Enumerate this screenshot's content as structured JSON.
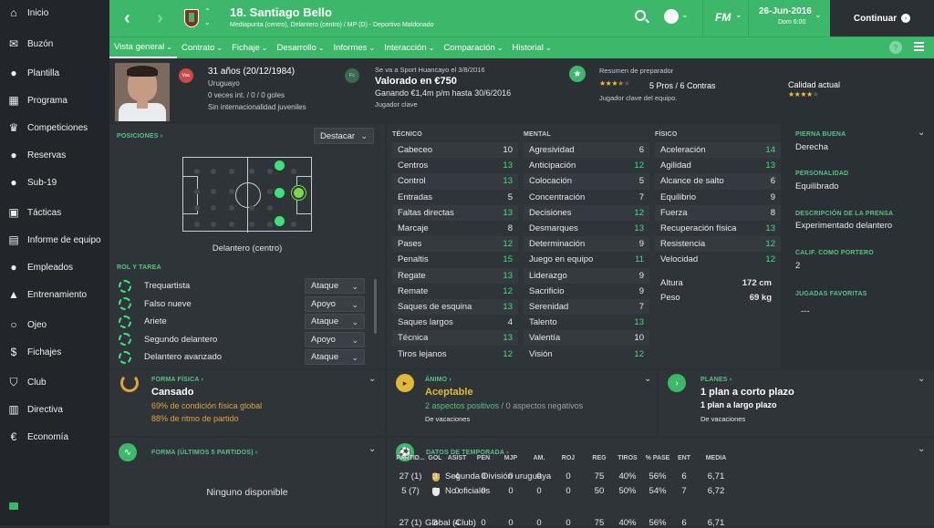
{
  "sidebar": {
    "items": [
      {
        "label": "Inicio",
        "icon": "home-icon"
      },
      {
        "label": "Buzón",
        "icon": "inbox-icon"
      },
      {
        "label": "Plantilla",
        "icon": "squad-icon"
      },
      {
        "label": "Programa",
        "icon": "schedule-icon"
      },
      {
        "label": "Competiciones",
        "icon": "trophy-icon"
      },
      {
        "label": "Reservas",
        "icon": "reserves-icon"
      },
      {
        "label": "Sub-19",
        "icon": "u19-icon"
      },
      {
        "label": "Tácticas",
        "icon": "tactics-icon"
      },
      {
        "label": "Informe de equipo",
        "icon": "report-icon"
      },
      {
        "label": "Empleados",
        "icon": "staff-icon"
      },
      {
        "label": "Entrenamiento",
        "icon": "training-icon"
      },
      {
        "label": "Ojeo",
        "icon": "scouting-icon"
      },
      {
        "label": "Fichajes",
        "icon": "transfers-icon"
      },
      {
        "label": "Club",
        "icon": "club-icon"
      },
      {
        "label": "Directiva",
        "icon": "board-icon"
      },
      {
        "label": "Economía",
        "icon": "finances-icon"
      }
    ]
  },
  "header": {
    "player_name": "18. Santiago Bello",
    "subtitle": "Mediapunta (centro), Delantero (centro) / MP (D) - Deportivo Maldonado",
    "logo": "FM",
    "date": "26-Jun-2016",
    "time": "Dom 6:00",
    "continue_label": "Continuar"
  },
  "nav": {
    "tabs": [
      "Vista general",
      "Contrato",
      "Fichaje",
      "Desarrollo",
      "Informes",
      "Interacción",
      "Comparación",
      "Historial"
    ]
  },
  "profile": {
    "age": "31 años (20/12/1984)",
    "nationality": "Uruguayo",
    "caps": "0 veces int. / 0 / 0 goles",
    "youth": "Sin internacionalidad juveniles",
    "badge": "Vac",
    "transfer_note": "Se va a Sport Huancayo el 3/8/2016",
    "value": "Valorado en €750",
    "wage": "Ganando €1,4m p/m hasta 30/6/2016",
    "status": "Jugador clave",
    "badge2": "Fc",
    "coach_title": "Resumen de preparador",
    "pros_cons": "5 Pros / 6 Contras",
    "coach_note": "Jugador clave del equipo.",
    "current_ability": "Calidad actual",
    "pros_stars": 3.5,
    "ability_stars": 4
  },
  "positions": {
    "title": "POSICIONES",
    "highlight_label": "Destacar",
    "position_label": "Delantero (centro)"
  },
  "roles": {
    "title": "ROL Y TAREA",
    "items": [
      {
        "role": "Trequartista",
        "duty": "Ataque"
      },
      {
        "role": "Falso nueve",
        "duty": "Apoyo"
      },
      {
        "role": "Ariete",
        "duty": "Ataque"
      },
      {
        "role": "Segundo delantero",
        "duty": "Apoyo"
      },
      {
        "role": "Delantero avanzado",
        "duty": "Ataque"
      }
    ]
  },
  "technical": {
    "title": "TÉCNICO",
    "items": [
      {
        "name": "Cabeceo",
        "value": "10"
      },
      {
        "name": "Centros",
        "value": "13"
      },
      {
        "name": "Control",
        "value": "13"
      },
      {
        "name": "Entradas",
        "value": "5"
      },
      {
        "name": "Faltas directas",
        "value": "13"
      },
      {
        "name": "Marcaje",
        "value": "8"
      },
      {
        "name": "Pases",
        "value": "12"
      },
      {
        "name": "Penaltis",
        "value": "15"
      },
      {
        "name": "Regate",
        "value": "13"
      },
      {
        "name": "Remate",
        "value": "12"
      },
      {
        "name": "Saques de esquina",
        "value": "13"
      },
      {
        "name": "Saques largos",
        "value": "4"
      },
      {
        "name": "Técnica",
        "value": "13"
      },
      {
        "name": "Tiros lejanos",
        "value": "12"
      }
    ]
  },
  "mental": {
    "title": "MENTAL",
    "items": [
      {
        "name": "Agresividad",
        "value": "6"
      },
      {
        "name": "Anticipación",
        "value": "12"
      },
      {
        "name": "Colocación",
        "value": "5"
      },
      {
        "name": "Concentración",
        "value": "7"
      },
      {
        "name": "Decisiones",
        "value": "12"
      },
      {
        "name": "Desmarques",
        "value": "13"
      },
      {
        "name": "Determinación",
        "value": "9"
      },
      {
        "name": "Juego en equipo",
        "value": "11"
      },
      {
        "name": "Liderazgo",
        "value": "9"
      },
      {
        "name": "Sacrificio",
        "value": "9"
      },
      {
        "name": "Serenidad",
        "value": "7"
      },
      {
        "name": "Talento",
        "value": "13"
      },
      {
        "name": "Valentía",
        "value": "10"
      },
      {
        "name": "Visión",
        "value": "12"
      }
    ]
  },
  "physical": {
    "title": "FÍSICO",
    "items": [
      {
        "name": "Aceleración",
        "value": "14"
      },
      {
        "name": "Agilidad",
        "value": "13"
      },
      {
        "name": "Alcance de salto",
        "value": "6"
      },
      {
        "name": "Equilibrio",
        "value": "9"
      },
      {
        "name": "Fuerza",
        "value": "8"
      },
      {
        "name": "Recuperación física",
        "value": "13"
      },
      {
        "name": "Resistencia",
        "value": "12"
      },
      {
        "name": "Velocidad",
        "value": "12"
      }
    ],
    "height_label": "Altura",
    "height": "172 cm",
    "weight_label": "Peso",
    "weight": "69 kg"
  },
  "details": {
    "foot_title": "PIERNA BUENA",
    "foot": "Derecha",
    "personality_title": "PERSONALIDAD",
    "personality": "Equilibrado",
    "press_title": "DESCRIPCIÓN DE LA PRENSA",
    "press": "Experimentado delantero",
    "gk_title": "CALIF. COMO PORTERO",
    "gk": "2",
    "moves_title": "JUGADAS FAVORITAS",
    "moves": "---"
  },
  "condition": {
    "title": "FORMA FÍSICA",
    "state": "Cansado",
    "line1": "69% de condición física global",
    "line2": "88% de ritmo de partido"
  },
  "morale": {
    "title": "ÁNIMO",
    "state": "Aceptable",
    "positives": "2 aspectos positivos",
    "negatives": "0 aspectos negativos",
    "note": "De vacaciones"
  },
  "plans": {
    "title": "PLANES",
    "short": "1 plan a corto plazo",
    "long": "1 plan a largo plazo",
    "note": "De vacaciones"
  },
  "form": {
    "title": "FORMA (ÚLTIMOS 5 PARTIDOS)",
    "empty": "Ninguno disponible"
  },
  "season": {
    "title": "DATOS DE TEMPORADA",
    "columns": [
      "PARTID...",
      "GOL",
      "ASIST",
      "PEN",
      "MJP",
      "AM.",
      "ROJ",
      "REG",
      "TIROS",
      "% PASE",
      "ENT",
      "MEDIA"
    ],
    "rows": [
      {
        "name": "Segunda División uruguaya",
        "cells": [
          "27 (1)",
          "3",
          "4",
          "0",
          "0",
          "0",
          "0",
          "75",
          "40%",
          "56%",
          "6",
          "6,71"
        ]
      },
      {
        "name": "No oficiales",
        "cells": [
          "5 (7)",
          "2",
          "0",
          "0",
          "0",
          "0",
          "0",
          "50",
          "50%",
          "54%",
          "7",
          "6,72"
        ]
      }
    ],
    "total": {
      "name": "Global (Club)",
      "cells": [
        "27 (1)",
        "3",
        "4",
        "0",
        "0",
        "0",
        "0",
        "75",
        "40%",
        "56%",
        "6",
        "6,71"
      ]
    }
  }
}
